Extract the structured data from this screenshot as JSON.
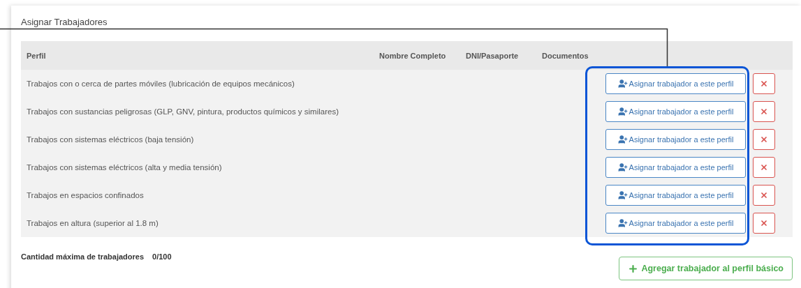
{
  "card": {
    "title": "Asignar Trabajadores"
  },
  "table": {
    "columns": [
      "Perfil",
      "Nombre Completo",
      "DNI/Pasaporte",
      "Documentos"
    ],
    "rows": [
      {
        "perfil": "Trabajos con o cerca de partes móviles (lubricación de equipos mecánicos)",
        "assign_button": "Asignar trabajador a este perfil"
      },
      {
        "perfil": "Trabajos con sustancias peligrosas (GLP, GNV, pintura, productos químicos y similares)",
        "assign_button": "Asignar trabajador a este perfil"
      },
      {
        "perfil": "Trabajos con sistemas eléctricos (baja tensión)",
        "assign_button": "Asignar trabajador a este perfil"
      },
      {
        "perfil": "Trabajos con sistemas eléctricos (alta y media tensión)",
        "assign_button": "Asignar trabajador a este perfil"
      },
      {
        "perfil": "Trabajos en espacios confinados",
        "assign_button": "Asignar trabajador a este perfil"
      },
      {
        "perfil": "Trabajos en altura (superior al 1.8 m)",
        "assign_button": "Asignar trabajador a este perfil"
      }
    ]
  },
  "footer": {
    "label": "Cantidad máxima de trabajadores",
    "value": "0/100",
    "add_button": "Agregar trabajador al perfil básico"
  }
}
